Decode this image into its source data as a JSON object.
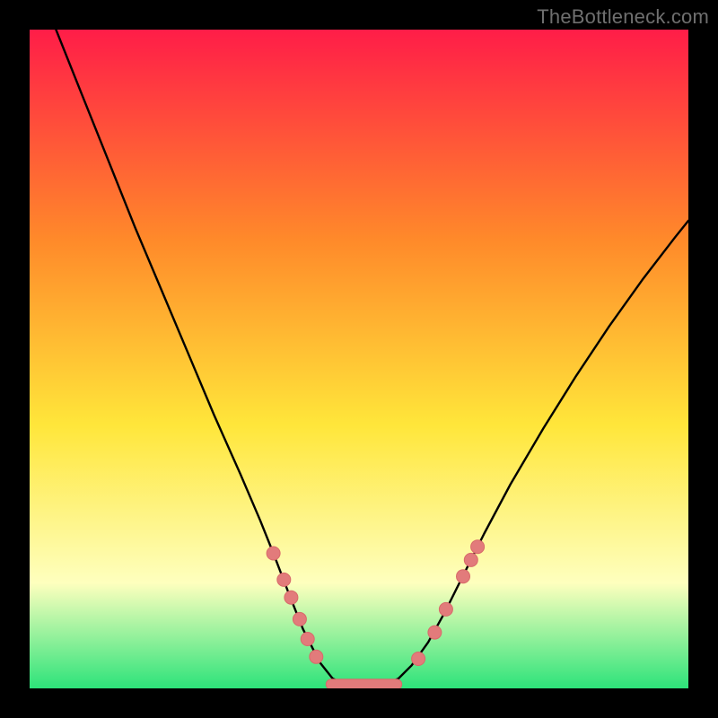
{
  "watermark": "TheBottleneck.com",
  "colors": {
    "gradient_top": "#ff1d48",
    "gradient_mid_orange": "#ff8a2a",
    "gradient_yellow": "#ffe63a",
    "gradient_pale": "#feffbe",
    "gradient_green": "#2de37a",
    "curve_stroke": "#000000",
    "marker_fill": "#e27b7b",
    "marker_stroke": "#d86a6a",
    "background": "#000000"
  },
  "chart_data": {
    "type": "line",
    "title": "",
    "xlabel": "",
    "ylabel": "",
    "x_range": [
      0,
      100
    ],
    "y_range": [
      0,
      100
    ],
    "curve": [
      {
        "x": 4.0,
        "y": 100.0
      },
      {
        "x": 8.0,
        "y": 90.0
      },
      {
        "x": 12.0,
        "y": 80.0
      },
      {
        "x": 16.0,
        "y": 70.0
      },
      {
        "x": 20.0,
        "y": 60.5
      },
      {
        "x": 24.0,
        "y": 51.0
      },
      {
        "x": 28.0,
        "y": 41.5
      },
      {
        "x": 32.0,
        "y": 32.5
      },
      {
        "x": 35.0,
        "y": 25.5
      },
      {
        "x": 37.0,
        "y": 20.5
      },
      {
        "x": 39.5,
        "y": 14.0
      },
      {
        "x": 41.5,
        "y": 9.0
      },
      {
        "x": 44.0,
        "y": 4.0
      },
      {
        "x": 46.0,
        "y": 1.5
      },
      {
        "x": 48.0,
        "y": 0.5
      },
      {
        "x": 50.0,
        "y": 0.2
      },
      {
        "x": 52.0,
        "y": 0.2
      },
      {
        "x": 54.0,
        "y": 0.5
      },
      {
        "x": 56.0,
        "y": 1.5
      },
      {
        "x": 58.0,
        "y": 3.5
      },
      {
        "x": 60.5,
        "y": 7.0
      },
      {
        "x": 63.0,
        "y": 11.5
      },
      {
        "x": 66.0,
        "y": 17.5
      },
      {
        "x": 69.0,
        "y": 23.5
      },
      {
        "x": 73.0,
        "y": 31.0
      },
      {
        "x": 78.0,
        "y": 39.5
      },
      {
        "x": 83.0,
        "y": 47.5
      },
      {
        "x": 88.0,
        "y": 55.0
      },
      {
        "x": 93.0,
        "y": 62.0
      },
      {
        "x": 98.0,
        "y": 68.5
      },
      {
        "x": 100.0,
        "y": 71.0
      }
    ],
    "markers_left": [
      {
        "x": 37.0,
        "y": 20.5
      },
      {
        "x": 38.6,
        "y": 16.5
      },
      {
        "x": 39.7,
        "y": 13.8
      },
      {
        "x": 41.0,
        "y": 10.5
      },
      {
        "x": 42.2,
        "y": 7.5
      },
      {
        "x": 43.5,
        "y": 4.8
      }
    ],
    "markers_right": [
      {
        "x": 59.0,
        "y": 4.5
      },
      {
        "x": 61.5,
        "y": 8.5
      },
      {
        "x": 63.2,
        "y": 12.0
      },
      {
        "x": 65.8,
        "y": 17.0
      },
      {
        "x": 67.0,
        "y": 19.5
      },
      {
        "x": 68.0,
        "y": 21.5
      }
    ],
    "bottom_bar": {
      "x1": 45.0,
      "x2": 56.5,
      "y": 0.6,
      "thickness_pct": 1.6
    }
  }
}
